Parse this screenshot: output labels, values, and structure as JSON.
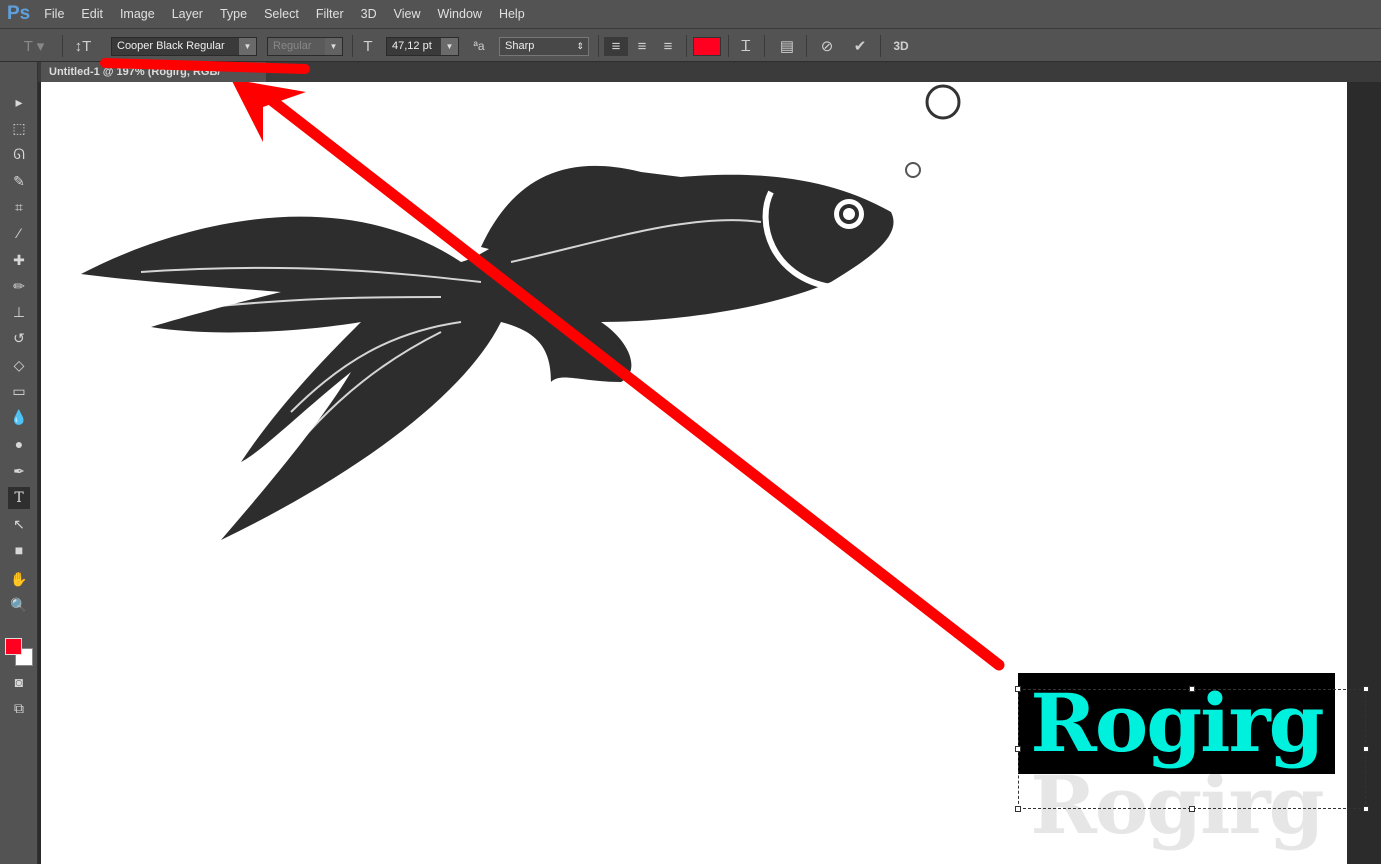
{
  "app": {
    "logo": "Ps"
  },
  "menu": [
    "File",
    "Edit",
    "Image",
    "Layer",
    "Type",
    "Select",
    "Filter",
    "3D",
    "View",
    "Window",
    "Help"
  ],
  "options": {
    "font_family": "Cooper Black Regular",
    "font_style": "Regular",
    "font_size": "47,12 pt",
    "antialias": "Sharp",
    "text_color": "#ff0021",
    "three_d_label": "3D"
  },
  "document_tab": {
    "title": "Untitled-1 @ 197% (Rogirg, RGB/"
  },
  "canvas": {
    "text_layer": "Rogirg",
    "text_color": "#00f0de",
    "text_bg": "#000000",
    "annotation_color": "#ff0000"
  },
  "tools": {
    "foreground": "#ff0021",
    "background": "#ffffff"
  }
}
